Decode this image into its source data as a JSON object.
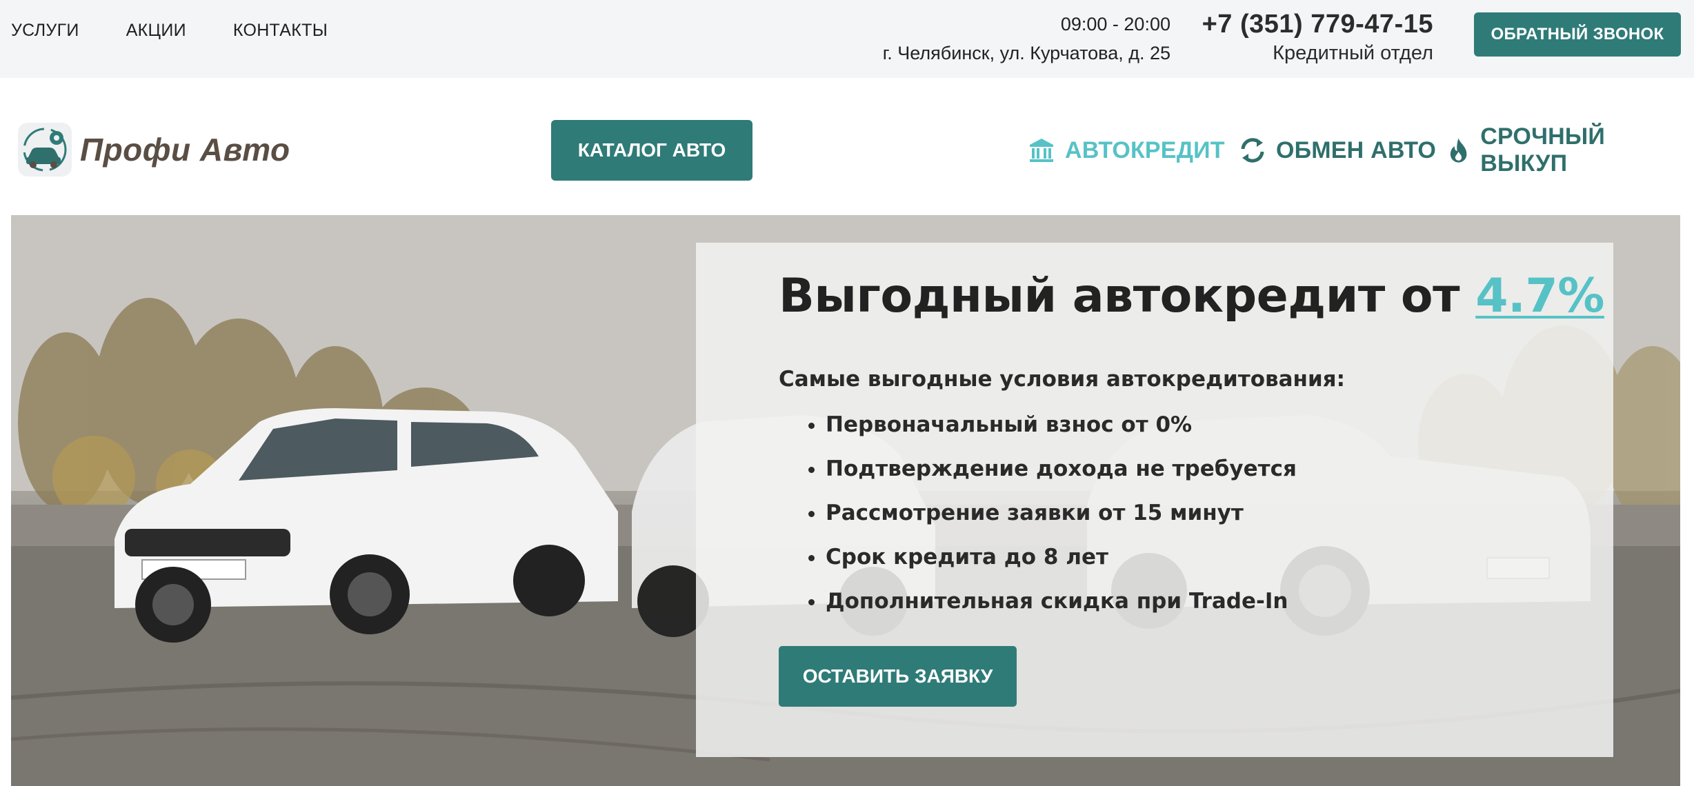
{
  "topbar": {
    "nav": [
      "УСЛУГИ",
      "АКЦИИ",
      "КОНТАКТЫ"
    ],
    "hours": "09:00 - 20:00",
    "address": "г. Челябинск, ул. Курчатова, д. 25",
    "phone": "+7 (351) 779-47-15",
    "department": "Кредитный отдел",
    "callback_label": "ОБРАТНЫЙ ЗВОНОК"
  },
  "header": {
    "logo_text": "Профи Авто",
    "catalog_label": "КАТАЛОГ АВТО",
    "nav": [
      {
        "label": "АВТОКРЕДИТ",
        "icon": "bank-icon",
        "active": true
      },
      {
        "label": "ОБМЕН АВТО",
        "icon": "exchange-arrows-icon",
        "active": false
      },
      {
        "label": "СРОЧНЫЙ ВЫКУП",
        "icon": "fire-icon",
        "active": false
      }
    ]
  },
  "hero": {
    "title_prefix": "Выгодный автокредит от ",
    "title_rate": "4.7%",
    "lead": "Самые выгодные условия автокредитования:",
    "bullets": [
      "Первоначальный взнос от 0%",
      "Подтверждение дохода не требуется",
      "Рассмотрение заявки от 15 минут",
      "Срок кредита до 8 лет",
      "Дополнительная скидка при Trade-In"
    ],
    "apply_label": "ОСТАВИТЬ ЗАЯВКУ"
  },
  "colors": {
    "accent": "#2f7b78",
    "highlight": "#56c2c6",
    "logo_text": "#5a4e44",
    "topbar_bg": "#f4f5f7"
  }
}
